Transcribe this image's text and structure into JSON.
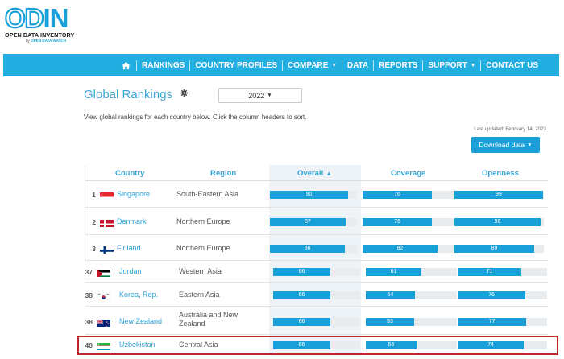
{
  "logo": {
    "mark_outline": "OD",
    "mark_solid": "IN",
    "subtitle": "OPEN DATA INVENTORY",
    "by": "by",
    "by_org": "OPEN DATA WATCH"
  },
  "nav": {
    "home_icon": "home-icon",
    "items": [
      {
        "label": "RANKINGS",
        "dropdown": false
      },
      {
        "label": "COUNTRY PROFILES",
        "dropdown": false
      },
      {
        "label": "COMPARE",
        "dropdown": true
      },
      {
        "label": "DATA",
        "dropdown": false
      },
      {
        "label": "REPORTS",
        "dropdown": false
      },
      {
        "label": "SUPPORT",
        "dropdown": true
      },
      {
        "label": "CONTACT US",
        "dropdown": false
      }
    ]
  },
  "page": {
    "title": "Global Rankings",
    "settings_icon": "gear-icon",
    "year": "2022",
    "intro": "View global rankings for each country below. Click the column headers to sort.",
    "last_updated": "Last updated: February 14, 2023",
    "download_label": "Download data"
  },
  "table": {
    "headers": {
      "country": "Country",
      "region": "Region",
      "overall": "Overall",
      "coverage": "Coverage",
      "openness": "Openness"
    },
    "sort_column": "overall",
    "sort_direction": "desc",
    "rows": [
      {
        "rank": "1",
        "flag": "singapore-flag-icon",
        "country": "Singapore",
        "region": "South-Eastern Asia",
        "overall": 90,
        "coverage": 76,
        "openness": 99
      },
      {
        "rank": "2",
        "flag": "denmark-flag-icon",
        "country": "Denmark",
        "region": "Northern Europe",
        "overall": 87,
        "coverage": 76,
        "openness": 96
      },
      {
        "rank": "3",
        "flag": "finland-flag-icon",
        "country": "Finland",
        "region": "Northern Europe",
        "overall": 86,
        "coverage": 82,
        "openness": 89
      },
      {
        "rank": "37",
        "flag": "jordan-flag-icon",
        "country": "Jordan",
        "region": "Western Asia",
        "overall": 66,
        "coverage": 61,
        "openness": 71
      },
      {
        "rank": "38",
        "flag": "korea-flag-icon",
        "country": "Korea, Rep.",
        "region": "Eastern Asia",
        "overall": 66,
        "coverage": 54,
        "openness": 76
      },
      {
        "rank": "38",
        "flag": "new-zealand-flag-icon",
        "country": "New Zealand",
        "region": "Australia and New Zealand",
        "overall": 66,
        "coverage": 53,
        "openness": 77
      },
      {
        "rank": "40",
        "flag": "uzbekistan-flag-icon",
        "country": "Uzbekistan",
        "region": "Central Asia",
        "overall": 66,
        "coverage": 56,
        "openness": 74
      }
    ]
  },
  "colors": {
    "brand": "#1aa0d8",
    "nav_bg": "#23aee2",
    "highlight_border": "#c0262c"
  }
}
